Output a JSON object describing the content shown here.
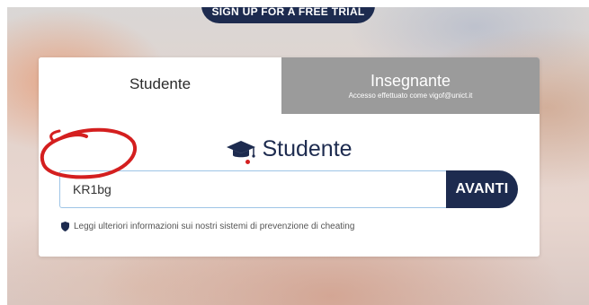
{
  "header": {
    "trial_button_label": "SIGN UP FOR A FREE TRIAL"
  },
  "tabs": {
    "student_label": "Studente",
    "teacher_label": "Insegnante",
    "teacher_subtitle": "Accesso effettuato come vigof@unict.it"
  },
  "main": {
    "heading": "Studente",
    "code_input_value": "KR1bg",
    "submit_label": "AVANTI",
    "cheat_link_text": "Leggi ulteriori informazioni sui nostri sistemi di prevenzione di cheating"
  },
  "icons": {
    "heading_icon": "graduation-cap-icon",
    "cheat_icon": "shield-icon"
  },
  "colors": {
    "brand_navy": "#1d2b4f",
    "tab_inactive": "#9b9b9b",
    "annotation_red": "#d41f1f",
    "input_border": "#9ec4e6"
  }
}
